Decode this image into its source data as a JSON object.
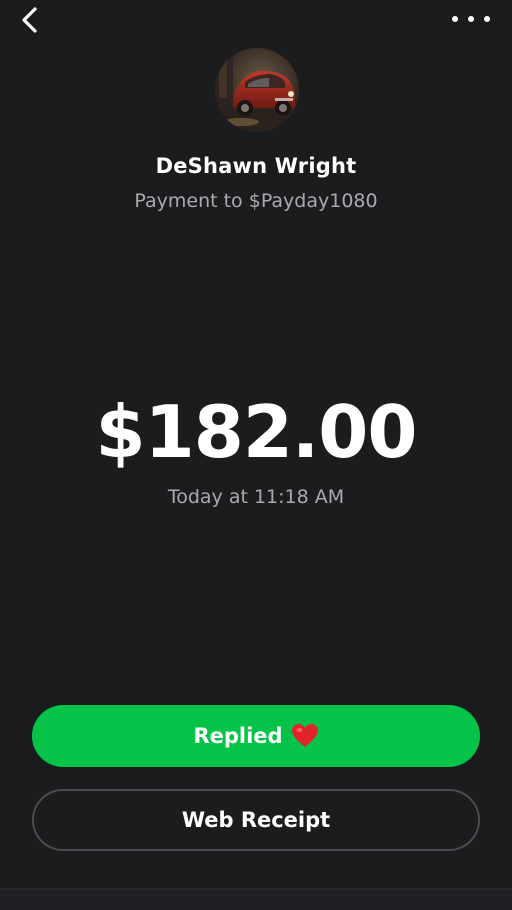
{
  "header": {
    "back_icon": "chevron-left-icon",
    "more_icon": "more-horizontal-icon"
  },
  "contact": {
    "avatar_description_icon": "car-photo-avatar",
    "name": "DeShawn Wright",
    "subtitle": "Payment to $Payday1080"
  },
  "payment": {
    "amount": "$182.00",
    "timestamp": "Today at 11:18 AM"
  },
  "actions": {
    "replied_label": "Replied",
    "replied_icon": "heart-icon",
    "receipt_label": "Web Receipt"
  },
  "colors": {
    "background": "#1a1c1e",
    "accent_green": "#05c349",
    "muted_text": "#a8aaad",
    "heart_red": "#e0242a"
  }
}
